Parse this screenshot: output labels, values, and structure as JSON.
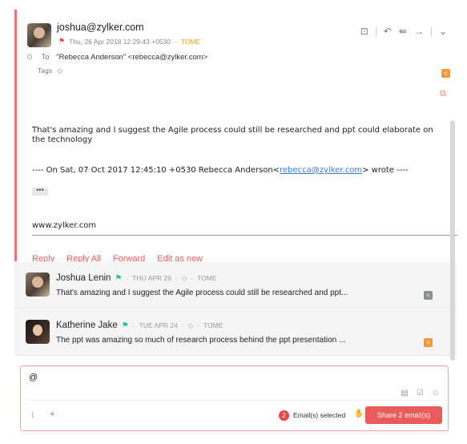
{
  "message": {
    "sender": "joshua@zylker.com",
    "date": "Thu, 26 Apr 2018 12:29:43 +0530",
    "tome": "TOME",
    "to_label": "To",
    "to_value": "\"Rebecca Anderson\" <rebecca@zylker.com>",
    "tags_label": "Tags",
    "body": "That's amazing  and I suggest the Agile process could still be researched and ppt could elaborate on the technology",
    "quote_prefix": "---- On Sat, 07 Oct 2017 12:45:10 +0530 Rebecca Anderson<",
    "quote_link": "rebecca@zylker.com",
    "quote_suffix": "> wrote ----",
    "ellipsis": "•••",
    "signature": "www.zylker.com"
  },
  "actions": {
    "reply": "Reply",
    "reply_all": "Reply All",
    "forward": "Forward",
    "edit": "Edit as new",
    "sep": "·"
  },
  "threads": [
    {
      "name": "Joshua Lenin",
      "date": "THU APR 26",
      "tome": "TOME",
      "snippet": "That's amazing and I suggest the Agile process could still be researched and ppt..."
    },
    {
      "name": "Katherine Jake",
      "date": "TUE APR 24",
      "tome": "TOME",
      "snippet": "The ppt was amazing so much of research process behind the ppt presentation ..."
    }
  ],
  "compose": {
    "text": "@",
    "selected_count": "2",
    "selected_label": "Email(s) selected",
    "share_button": "Share 2 email(s)"
  },
  "colors": {
    "accent": "#ea5b5b",
    "tome": "#f0a030",
    "flag_green": "#2fb89a"
  }
}
